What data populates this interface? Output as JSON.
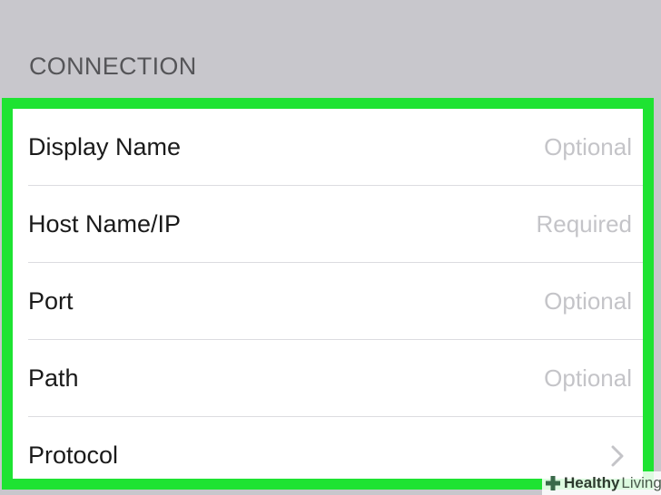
{
  "section": {
    "title": "CONNECTION"
  },
  "form": {
    "rows": [
      {
        "label": "Display Name",
        "placeholder": "Optional"
      },
      {
        "label": "Host Name/IP",
        "placeholder": "Required"
      },
      {
        "label": "Port",
        "placeholder": "Optional"
      },
      {
        "label": "Path",
        "placeholder": "Optional"
      },
      {
        "label": "Protocol",
        "icon": "chevron-right-icon"
      }
    ]
  },
  "watermark": {
    "brand_bold": "Healthy",
    "brand_light": "Living",
    "icon": "plus-cross-icon"
  },
  "colors": {
    "highlight": "#1ee332",
    "background": "#c8c7cc",
    "placeholder": "#c4c4c8"
  }
}
